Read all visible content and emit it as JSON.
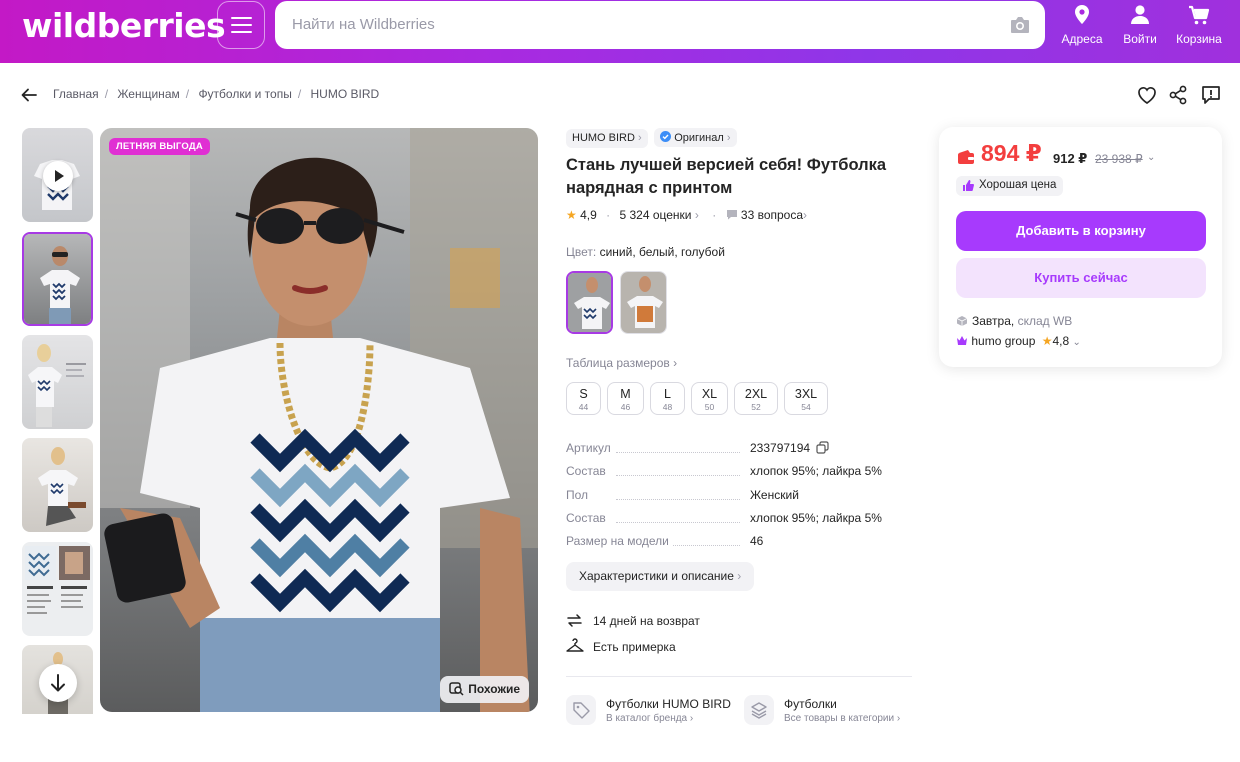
{
  "header": {
    "logo": "wildberries",
    "search_placeholder": "Найти на Wildberries",
    "address_label": "Адреса",
    "login_label": "Войти",
    "cart_label": "Корзина"
  },
  "breadcrumbs": [
    "Главная",
    "Женщинам",
    "Футболки и топы",
    "HUMO BIRD"
  ],
  "gallery": {
    "promo_badge": "ЛЕТНЯЯ ВЫГОДА",
    "similar_label": "Похожие"
  },
  "product": {
    "brand": "HUMO BIRD",
    "original_label": "Оригинал",
    "title": "Стань лучшей версией себя! Футболка нарядная с принтом",
    "rating": "4,9",
    "reviews": "5 324 оценки",
    "questions": "33 вопроса",
    "color_label": "Цвет:",
    "color_value": "синий, белый, голубой",
    "size_table_label": "Таблица размеров",
    "sizes": [
      {
        "size": "S",
        "ru": "44"
      },
      {
        "size": "M",
        "ru": "46"
      },
      {
        "size": "L",
        "ru": "48"
      },
      {
        "size": "XL",
        "ru": "50"
      },
      {
        "size": "2XL",
        "ru": "52"
      },
      {
        "size": "3XL",
        "ru": "54"
      }
    ],
    "specs": [
      {
        "key": "Артикул",
        "value": "233797194"
      },
      {
        "key": "Состав",
        "value": "хлопок 95%; лайкра 5%"
      },
      {
        "key": "Пол",
        "value": "Женский"
      },
      {
        "key": "Состав",
        "value": "хлопок 95%; лайкра 5%"
      },
      {
        "key": "Размер на модели",
        "value": "46"
      }
    ],
    "characteristics_button": "Характеристики и описание",
    "return_policy": "14 дней на возврат",
    "fitting": "Есть примерка",
    "brand_catalog_title": "Футболки HUMO BIRD",
    "brand_catalog_link": "В каталог бренда",
    "category_title": "Футболки",
    "category_link": "Все товары в категории"
  },
  "price_card": {
    "price": "894 ₽",
    "price_alt": "912 ₽",
    "price_old": "23 938 ₽",
    "good_price_label": "Хорошая цена",
    "add_to_cart": "Добавить в корзину",
    "buy_now": "Купить сейчас",
    "delivery_when": "Завтра,",
    "delivery_where": "склад WB",
    "seller_name": "humo group",
    "seller_rating": "4,8"
  },
  "colors": {
    "accent": "#a73afd",
    "price_red": "#f33e3e",
    "header_start": "#c319c6",
    "header_end": "#8f36e8"
  }
}
